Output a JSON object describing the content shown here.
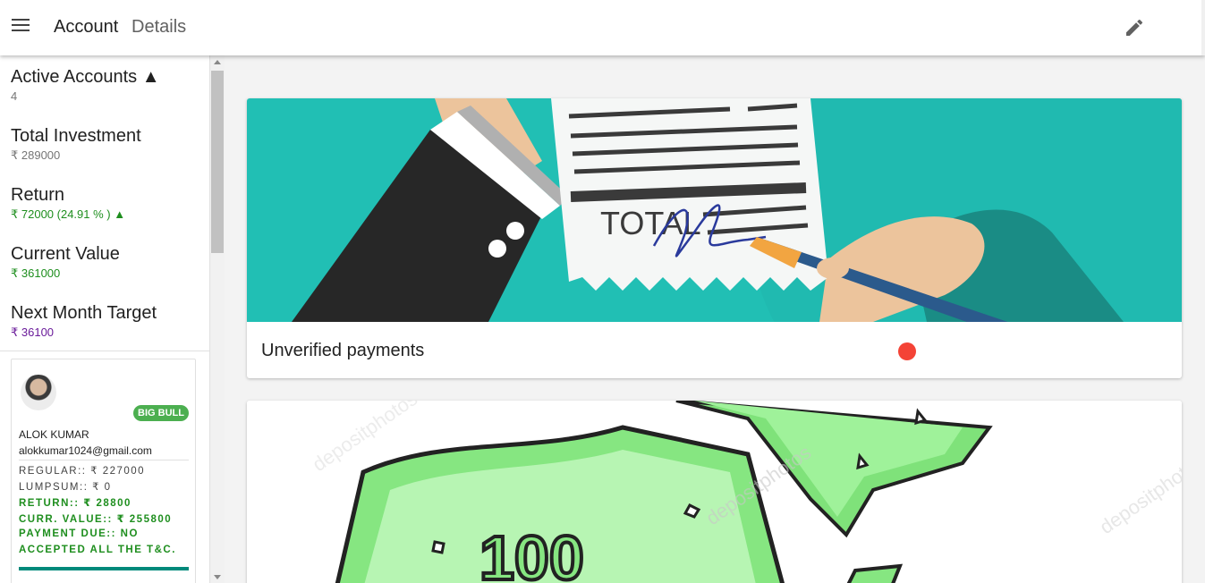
{
  "appbar": {
    "title": "Account",
    "subtitle": "Details",
    "menu_icon": "menu-icon",
    "edit_icon": "pencil-icon"
  },
  "sidebar": {
    "stats": [
      {
        "label": "Active Accounts ▲",
        "value": "4",
        "tone": "gray"
      },
      {
        "label": "Total Investment",
        "value": "₹ 289000",
        "tone": "gray"
      },
      {
        "label": "Return",
        "value": "₹ 72000 (24.91 % ) ▲",
        "tone": "green"
      },
      {
        "label": "Current Value",
        "value": "₹ 361000",
        "tone": "green"
      },
      {
        "label": "Next Month Target",
        "value": "₹ 36100",
        "tone": "purple"
      }
    ],
    "user": {
      "badge": "BIG BULL",
      "name": "ALOK KUMAR",
      "email": "alokkumar1024@gmail.com",
      "regular": "REGULAR:: ₹ 227000",
      "lumpsum": "LUMPSUM:: ₹ 0",
      "return": "RETURN:: ₹ 28800",
      "current_value": "CURR. VALUE:: ₹ 255800",
      "payment_due": "PAYMENT DUE:: NO",
      "terms": "ACCEPTED ALL THE T&C.",
      "progress": 1.0
    }
  },
  "cards": [
    {
      "title": "Unverified payments",
      "status_color": "#f44336"
    }
  ],
  "colors": {
    "accent_teal": "#21bfb4",
    "status_green": "#1e8e1e",
    "target_purple": "#6a1b9a",
    "badge_green": "#4caf50"
  }
}
